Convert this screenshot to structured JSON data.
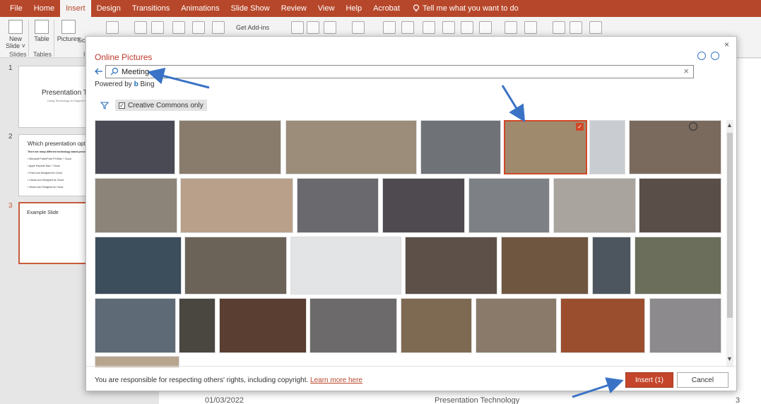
{
  "ribbon_tabs": [
    "File",
    "Home",
    "Insert",
    "Design",
    "Transitions",
    "Animations",
    "Slide Show",
    "Review",
    "View",
    "Help",
    "Acrobat"
  ],
  "active_tab": "Insert",
  "tell_me": "Tell me what you want to do",
  "ribbon": {
    "new_slide": "New Slide ˅",
    "slides_group": "Slides",
    "table": "Table",
    "tables_group": "Tables",
    "pictures": "Pictures",
    "screenshot_partial": "Scr",
    "images_group_partial": "Im",
    "get_addins": "Get Add-ins"
  },
  "slides": [
    {
      "number": "1",
      "title": "Presentation Tech",
      "subtitle": "Using Technology to Support Your"
    },
    {
      "number": "2",
      "title": "Which presentation option?",
      "lines": [
        "There are many different technology based presentat",
        "• Microsoft PowerPoint      PC/Mac + Cloud",
        "• Apple Keynote                Mac + Cloud",
        "• Prezi.com                      Designed for Cloud",
        "• Canva.com                    Designed for Cloud",
        "• Visme.com                    Designed for Cloud"
      ]
    },
    {
      "number": "3",
      "title": "Example Slide",
      "selected": true
    }
  ],
  "slide_footer": {
    "date": "01/03/2022",
    "title": "Presentation Technology",
    "page": "3"
  },
  "dialog": {
    "title": "Online Pictures",
    "close": "×",
    "search_value": "Meeting",
    "clear": "×",
    "powered_by": "Powered by",
    "powered_brand": "Bing",
    "filter_label": "Creative Commons only",
    "filter_checked": true,
    "disclaimer": "You are responsible for respecting others' rights, including copyright.",
    "learn_more": "Learn more here",
    "insert_button": "Insert (1)",
    "cancel_button": "Cancel",
    "selected_image_index": 5
  },
  "colors": {
    "accent": "#b7472a",
    "insert_button": "#c4452a",
    "annotation_arrow": "#3a73c6",
    "bing": "#1c6ab0"
  },
  "icons": [
    "search-icon",
    "back-arrow-icon",
    "filter-icon",
    "smile-icon",
    "frown-icon",
    "close-icon",
    "check-icon",
    "lightbulb-icon"
  ]
}
